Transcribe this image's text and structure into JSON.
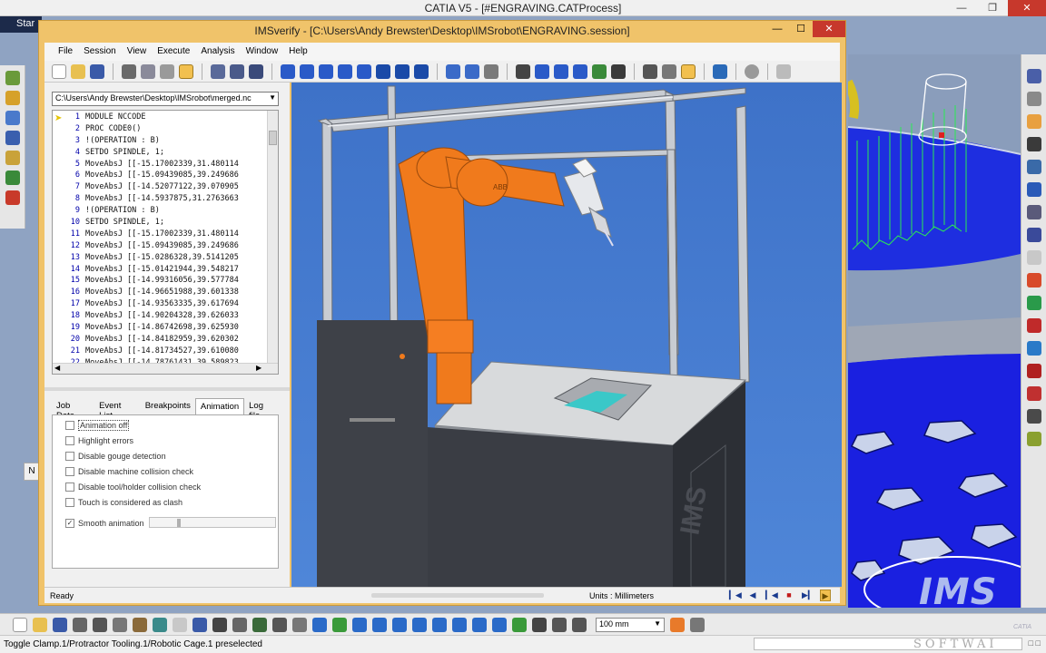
{
  "catia": {
    "title": "CATIA V5 - [#ENGRAVING.CATProcess]",
    "tab_label": "Star",
    "left_stub_label": "N",
    "status_text": "Toggle Clamp.1/Protractor Tooling.1/Robotic Cage.1 preselected",
    "zoom_value": "100 mm",
    "logo_text": "IMS",
    "logo_sub": "SOFTWAI",
    "logo_small": "CATIA"
  },
  "ims": {
    "title": "IMSverify - [C:\\Users\\Andy Brewster\\Desktop\\IMSrobot\\ENGRAVING.session]",
    "menus": [
      "File",
      "Session",
      "View",
      "Execute",
      "Analysis",
      "Window",
      "Help"
    ],
    "file_path": "C:\\Users\\Andy Brewster\\Desktop\\IMSrobot\\merged.nc",
    "code_lines": [
      {
        "n": "1",
        "t": "MODULE NCCODE"
      },
      {
        "n": "2",
        "t": "PROC CODE0()"
      },
      {
        "n": "3",
        "t": "!(OPERATION : B)"
      },
      {
        "n": "4",
        "t": "SETDO SPINDLE, 1;"
      },
      {
        "n": "5",
        "t": "MoveAbsJ [[-15.17002339,31.480114"
      },
      {
        "n": "6",
        "t": "MoveAbsJ [[-15.09439085,39.249686"
      },
      {
        "n": "7",
        "t": "MoveAbsJ [[-14.52077122,39.070905"
      },
      {
        "n": "8",
        "t": "MoveAbsJ [[-14.5937875,31.2763663"
      },
      {
        "n": "9",
        "t": "!(OPERATION : B)"
      },
      {
        "n": "10",
        "t": "SETDO SPINDLE, 1;"
      },
      {
        "n": "11",
        "t": "MoveAbsJ [[-15.17002339,31.480114"
      },
      {
        "n": "12",
        "t": "MoveAbsJ [[-15.09439085,39.249686"
      },
      {
        "n": "13",
        "t": "MoveAbsJ [[-15.0286328,39.5141205"
      },
      {
        "n": "14",
        "t": "MoveAbsJ [[-15.01421944,39.548217"
      },
      {
        "n": "15",
        "t": "MoveAbsJ [[-14.99316056,39.577784"
      },
      {
        "n": "16",
        "t": "MoveAbsJ [[-14.96651988,39.601338"
      },
      {
        "n": "17",
        "t": "MoveAbsJ [[-14.93563335,39.617694"
      },
      {
        "n": "18",
        "t": "MoveAbsJ [[-14.90204328,39.626033"
      },
      {
        "n": "19",
        "t": "MoveAbsJ [[-14.86742698,39.625930"
      },
      {
        "n": "20",
        "t": "MoveAbsJ [[-14.84182959,39.620302"
      },
      {
        "n": "21",
        "t": "MoveAbsJ [[-14.81734527,39.610080"
      },
      {
        "n": "22",
        "t": "MoveAbsJ [[-14.78761431,39.589823"
      }
    ],
    "tabs": [
      "Job Data",
      "Event List",
      "Breakpoints",
      "Animation",
      "Log file"
    ],
    "active_tab": "Animation",
    "options": [
      {
        "label": "Animation off",
        "checked": false,
        "focused": true
      },
      {
        "label": "Highlight errors",
        "checked": false
      },
      {
        "label": "Disable gouge detection",
        "checked": false
      },
      {
        "label": "Disable machine collision check",
        "checked": false
      },
      {
        "label": "Disable tool/holder collision check",
        "checked": false
      },
      {
        "label": "Touch is considered as clash",
        "checked": false
      },
      {
        "label": "Smooth animation",
        "checked": true
      }
    ],
    "status_ready": "Ready",
    "status_units": "Units : Millimeters",
    "robot_brand": "ABB",
    "cabinet_logo": "IMS"
  },
  "colors": {
    "ims_frame": "#f0c36a",
    "viewport_blue": "#4a80d4",
    "robot_orange": "#f07a1c",
    "catia_blue": "#1020d8",
    "toolpath_green": "#27e04a"
  }
}
